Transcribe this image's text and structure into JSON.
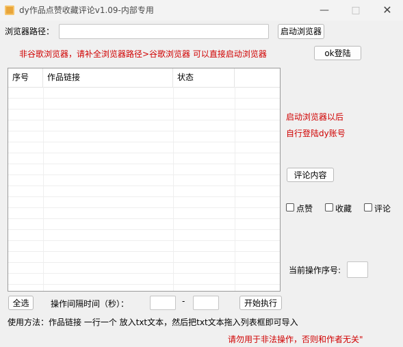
{
  "window": {
    "title": "dy作品点赞收藏评论v1.09-内部专用",
    "minimize_icon": "minimize-icon",
    "maximize_icon": "maximize-icon",
    "close_icon": "close-icon"
  },
  "browser": {
    "path_label": "浏览器路径：",
    "path_value": "",
    "launch_button": "启动浏览器",
    "hint": "非谷歌浏览器，请补全浏览器路径>谷歌浏览器 可以直接启动浏览器",
    "login_button": "ok登陆"
  },
  "table": {
    "columns": [
      "序号",
      "作品链接",
      "状态",
      ""
    ],
    "rows": []
  },
  "side": {
    "note_line1": "启动浏览器以后",
    "note_line2": "自行登陆dy账号",
    "comment_button": "评论内容",
    "options": [
      {
        "label": "点赞",
        "checked": false
      },
      {
        "label": "收藏",
        "checked": false
      },
      {
        "label": "评论",
        "checked": false
      }
    ],
    "current_index_label": "当前操作序号:",
    "current_index_value": ""
  },
  "bottom": {
    "select_all_button": "全选",
    "interval_label": "操作间隔时间（秒）：",
    "interval_min": "",
    "interval_sep": "-",
    "interval_max": "",
    "start_button": "开始执行",
    "usage": "使用方法：作品链接 一行一个 放入txt文本，然后把txt文本拖入列表框即可导入",
    "warning": "请勿用于非法操作，否则和作者无关\""
  },
  "colors": {
    "warning_red": "#d00000",
    "background": "#f0f0f0"
  }
}
